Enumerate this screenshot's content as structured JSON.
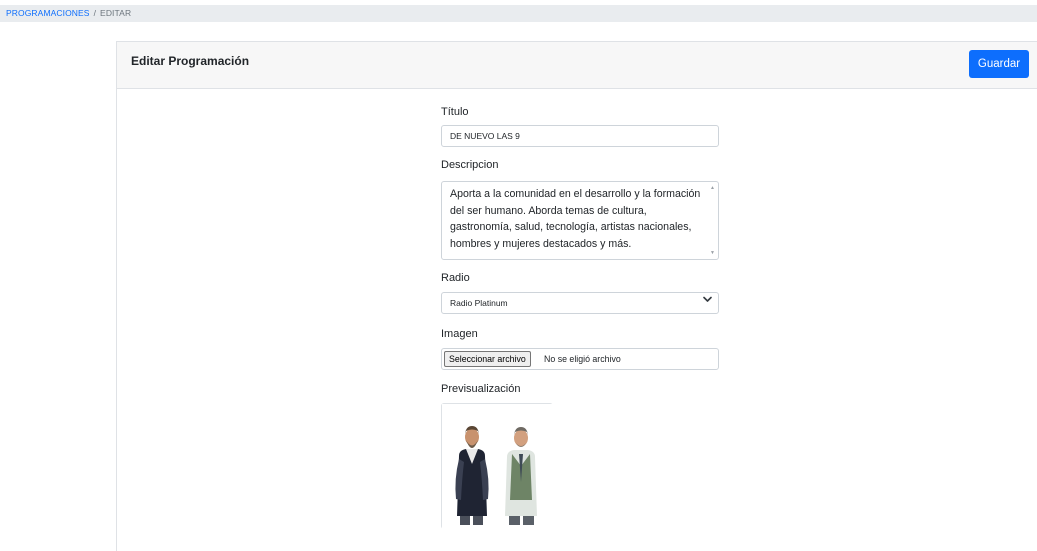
{
  "breadcrumb": {
    "parent": "PROGRAMACIONES",
    "separator": "/",
    "current": "EDITAR"
  },
  "card": {
    "title": "Editar Programación",
    "save_label": "Guardar"
  },
  "form": {
    "titulo": {
      "label": "Título",
      "value": "DE NUEVO LAS 9"
    },
    "descripcion": {
      "label": "Descripcion",
      "value": "Aporta a la comunidad en el desarrollo y la formación del ser humano. Aborda temas de cultura, gastronomía, salud, tecnología, artistas nacionales, hombres y mujeres destacados y más."
    },
    "radio": {
      "label": "Radio",
      "selected": "Radio Platinum"
    },
    "imagen": {
      "label": "Imagen",
      "button_label": "Seleccionar archivo",
      "status": "No se eligió archivo"
    },
    "preview": {
      "label": "Previsualización"
    }
  },
  "colors": {
    "primary": "#0d6efd",
    "header_bg": "#f7f7f7",
    "breadcrumb_bg": "#e9ecef"
  },
  "icons": {
    "select": "chevron-down-icon",
    "scroll": "scroll-arrow-icon"
  }
}
